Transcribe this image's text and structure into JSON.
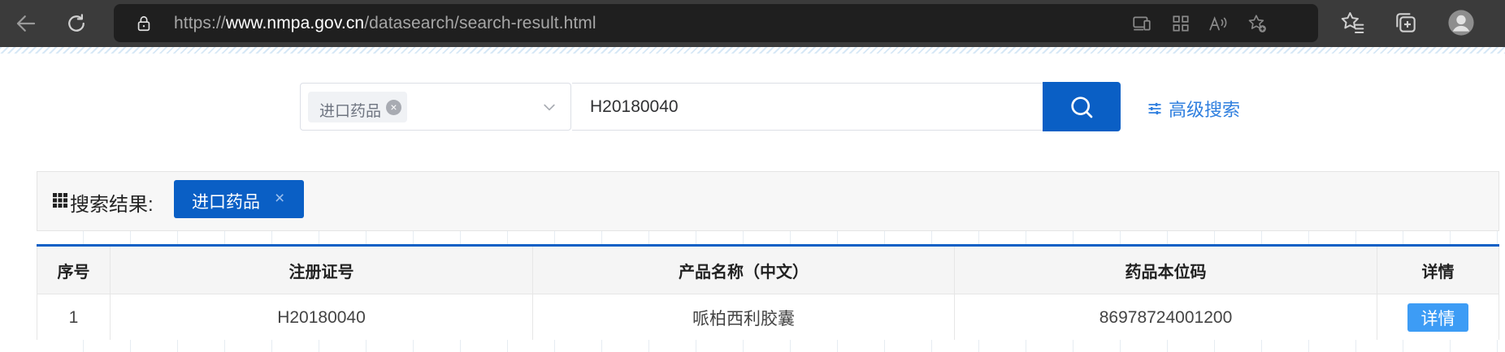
{
  "browser": {
    "url_prefix": "https://",
    "url_domain": "www.nmpa.gov.cn",
    "url_path": "/datasearch/search-result.html"
  },
  "search": {
    "category_tag": "进口药品",
    "tag_remove": "×",
    "query": "H20180040",
    "advanced_label": "高级搜索"
  },
  "results": {
    "label": "搜索结果:",
    "active_filter": "进口药品",
    "filter_remove": "×"
  },
  "table": {
    "headers": [
      "序号",
      "注册证号",
      "产品名称（中文）",
      "药品本位码",
      "详情"
    ],
    "rows": [
      {
        "index": "1",
        "reg_no": "H20180040",
        "name": "哌柏西利胶囊",
        "code": "86978724001200",
        "detail": "详情"
      }
    ]
  },
  "colors": {
    "brand_blue": "#0a5fc5",
    "detail_button": "#3d9cf5",
    "link_blue": "#2f7fdf"
  }
}
